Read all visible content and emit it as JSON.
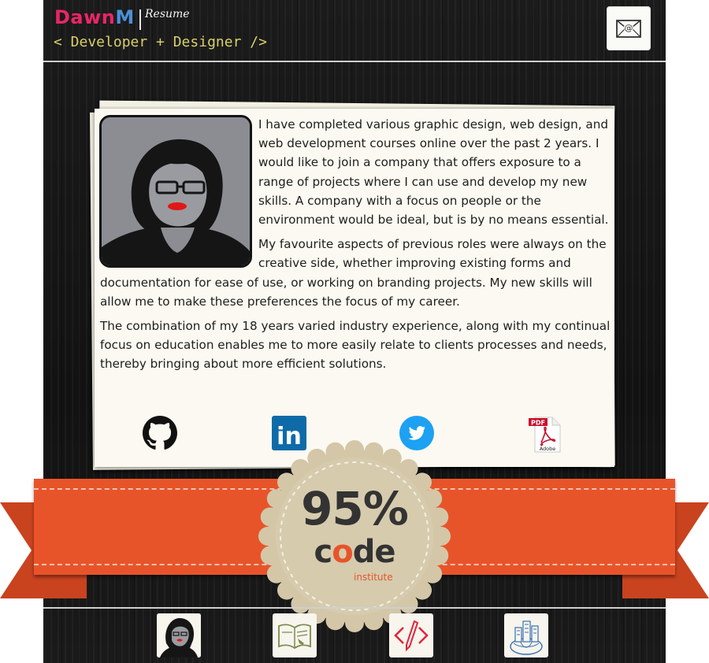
{
  "header": {
    "brand_part1": "Dawn",
    "brand_part2": "M",
    "subtitle": "Resume",
    "tagline": "< Developer + Designer />",
    "contact_icon": "mail-icon"
  },
  "about": {
    "paragraphs": [
      "I have completed various graphic design, web design, and web development courses online over the past 2 years. I would like to join a company that offers exposure to a range of projects where I can use and develop my new skills. A company with a focus on people or the environment would be ideal, but is by no means essential.",
      "My favourite aspects of previous roles were always on the creative side, whether improving existing forms and documentation for ease of use, or working on branding projects. My new skills will allow me to make these preferences the focus of my career.",
      "The combination of my 18 years varied industry experience, along with my continual focus on education enables me to more easily relate to clients processes and needs, thereby bringing about more efficient solutions."
    ]
  },
  "social": {
    "github_icon": "github-icon",
    "linkedin_icon": "linkedin-icon",
    "linkedin_text": "in",
    "twitter_icon": "twitter-icon",
    "pdf_icon": "pdf-icon",
    "pdf_label": "PDF",
    "pdf_brand": "Adobe"
  },
  "badge": {
    "percent": "95%",
    "code_c": "c",
    "code_o": "o",
    "code_de": "de",
    "institute": "institute"
  },
  "nav": {
    "items": [
      "about-me",
      "education",
      "code",
      "portfolio"
    ]
  },
  "colors": {
    "brand_pink": "#ea2566",
    "brand_blue": "#4b8fd6",
    "tagline": "#d8cf6a",
    "ribbon": "#e8542a",
    "seal": "#d3c7a8",
    "paper": "#fbf9f1"
  }
}
